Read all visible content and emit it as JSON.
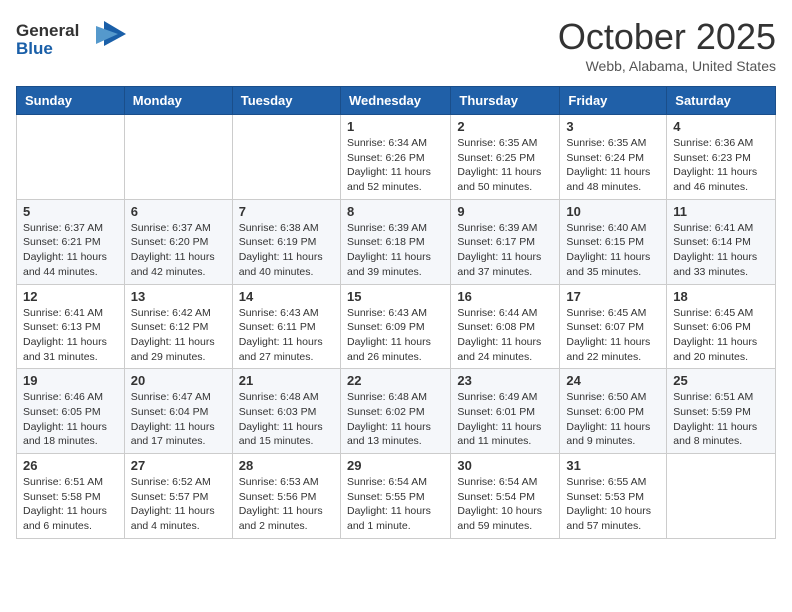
{
  "logo": {
    "line1": "General",
    "line2": "Blue"
  },
  "title": "October 2025",
  "location": "Webb, Alabama, United States",
  "weekdays": [
    "Sunday",
    "Monday",
    "Tuesday",
    "Wednesday",
    "Thursday",
    "Friday",
    "Saturday"
  ],
  "weeks": [
    [
      {
        "day": "",
        "info": ""
      },
      {
        "day": "",
        "info": ""
      },
      {
        "day": "",
        "info": ""
      },
      {
        "day": "1",
        "info": "Sunrise: 6:34 AM\nSunset: 6:26 PM\nDaylight: 11 hours\nand 52 minutes."
      },
      {
        "day": "2",
        "info": "Sunrise: 6:35 AM\nSunset: 6:25 PM\nDaylight: 11 hours\nand 50 minutes."
      },
      {
        "day": "3",
        "info": "Sunrise: 6:35 AM\nSunset: 6:24 PM\nDaylight: 11 hours\nand 48 minutes."
      },
      {
        "day": "4",
        "info": "Sunrise: 6:36 AM\nSunset: 6:23 PM\nDaylight: 11 hours\nand 46 minutes."
      }
    ],
    [
      {
        "day": "5",
        "info": "Sunrise: 6:37 AM\nSunset: 6:21 PM\nDaylight: 11 hours\nand 44 minutes."
      },
      {
        "day": "6",
        "info": "Sunrise: 6:37 AM\nSunset: 6:20 PM\nDaylight: 11 hours\nand 42 minutes."
      },
      {
        "day": "7",
        "info": "Sunrise: 6:38 AM\nSunset: 6:19 PM\nDaylight: 11 hours\nand 40 minutes."
      },
      {
        "day": "8",
        "info": "Sunrise: 6:39 AM\nSunset: 6:18 PM\nDaylight: 11 hours\nand 39 minutes."
      },
      {
        "day": "9",
        "info": "Sunrise: 6:39 AM\nSunset: 6:17 PM\nDaylight: 11 hours\nand 37 minutes."
      },
      {
        "day": "10",
        "info": "Sunrise: 6:40 AM\nSunset: 6:15 PM\nDaylight: 11 hours\nand 35 minutes."
      },
      {
        "day": "11",
        "info": "Sunrise: 6:41 AM\nSunset: 6:14 PM\nDaylight: 11 hours\nand 33 minutes."
      }
    ],
    [
      {
        "day": "12",
        "info": "Sunrise: 6:41 AM\nSunset: 6:13 PM\nDaylight: 11 hours\nand 31 minutes."
      },
      {
        "day": "13",
        "info": "Sunrise: 6:42 AM\nSunset: 6:12 PM\nDaylight: 11 hours\nand 29 minutes."
      },
      {
        "day": "14",
        "info": "Sunrise: 6:43 AM\nSunset: 6:11 PM\nDaylight: 11 hours\nand 27 minutes."
      },
      {
        "day": "15",
        "info": "Sunrise: 6:43 AM\nSunset: 6:09 PM\nDaylight: 11 hours\nand 26 minutes."
      },
      {
        "day": "16",
        "info": "Sunrise: 6:44 AM\nSunset: 6:08 PM\nDaylight: 11 hours\nand 24 minutes."
      },
      {
        "day": "17",
        "info": "Sunrise: 6:45 AM\nSunset: 6:07 PM\nDaylight: 11 hours\nand 22 minutes."
      },
      {
        "day": "18",
        "info": "Sunrise: 6:45 AM\nSunset: 6:06 PM\nDaylight: 11 hours\nand 20 minutes."
      }
    ],
    [
      {
        "day": "19",
        "info": "Sunrise: 6:46 AM\nSunset: 6:05 PM\nDaylight: 11 hours\nand 18 minutes."
      },
      {
        "day": "20",
        "info": "Sunrise: 6:47 AM\nSunset: 6:04 PM\nDaylight: 11 hours\nand 17 minutes."
      },
      {
        "day": "21",
        "info": "Sunrise: 6:48 AM\nSunset: 6:03 PM\nDaylight: 11 hours\nand 15 minutes."
      },
      {
        "day": "22",
        "info": "Sunrise: 6:48 AM\nSunset: 6:02 PM\nDaylight: 11 hours\nand 13 minutes."
      },
      {
        "day": "23",
        "info": "Sunrise: 6:49 AM\nSunset: 6:01 PM\nDaylight: 11 hours\nand 11 minutes."
      },
      {
        "day": "24",
        "info": "Sunrise: 6:50 AM\nSunset: 6:00 PM\nDaylight: 11 hours\nand 9 minutes."
      },
      {
        "day": "25",
        "info": "Sunrise: 6:51 AM\nSunset: 5:59 PM\nDaylight: 11 hours\nand 8 minutes."
      }
    ],
    [
      {
        "day": "26",
        "info": "Sunrise: 6:51 AM\nSunset: 5:58 PM\nDaylight: 11 hours\nand 6 minutes."
      },
      {
        "day": "27",
        "info": "Sunrise: 6:52 AM\nSunset: 5:57 PM\nDaylight: 11 hours\nand 4 minutes."
      },
      {
        "day": "28",
        "info": "Sunrise: 6:53 AM\nSunset: 5:56 PM\nDaylight: 11 hours\nand 2 minutes."
      },
      {
        "day": "29",
        "info": "Sunrise: 6:54 AM\nSunset: 5:55 PM\nDaylight: 11 hours\nand 1 minute."
      },
      {
        "day": "30",
        "info": "Sunrise: 6:54 AM\nSunset: 5:54 PM\nDaylight: 10 hours\nand 59 minutes."
      },
      {
        "day": "31",
        "info": "Sunrise: 6:55 AM\nSunset: 5:53 PM\nDaylight: 10 hours\nand 57 minutes."
      },
      {
        "day": "",
        "info": ""
      }
    ]
  ]
}
